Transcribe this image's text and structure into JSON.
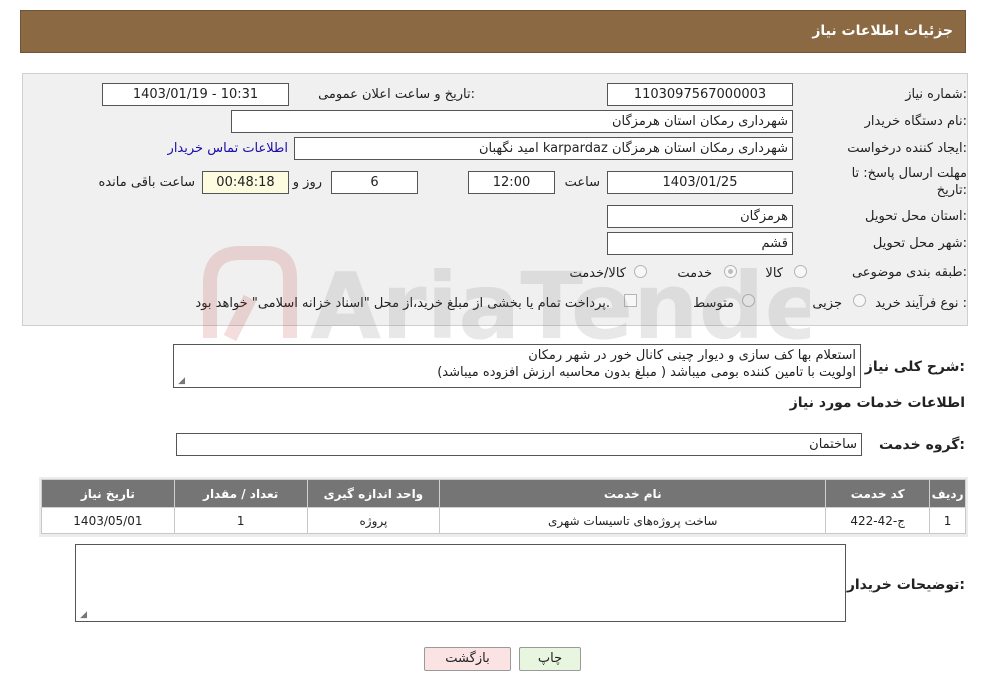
{
  "header": {
    "title": "جزئیات اطلاعات نیاز"
  },
  "form": {
    "need_number_label": "شماره نیاز:",
    "need_number": "1103097567000003",
    "announce_label": "تاریخ و ساعت اعلان عمومی:",
    "announce_value": "1403/01/19 - 10:31",
    "buyer_org_label": "نام دستگاه خریدار:",
    "buyer_org": "شهرداری رمکان استان هرمزگان",
    "creator_label": "ایجاد کننده درخواست:",
    "creator": "امید نگهبان karpardaz شهرداری رمکان استان هرمزگان",
    "contact_link": "اطلاعات تماس خریدار",
    "deadline_label_1": "مهلت ارسال پاسخ: تا",
    "deadline_label_2": "تاریخ:",
    "deadline_date": "1403/01/25",
    "time_label": "ساعت",
    "deadline_time": "12:00",
    "days_value": "6",
    "days_label": "روز و",
    "remaining_value": "00:48:18",
    "remaining_label": "ساعت باقی مانده",
    "province_label": "استان محل تحویل:",
    "province": "هرمزگان",
    "city_label": "شهر محل تحویل:",
    "city": "قشم",
    "category_label": "طبقه بندی موضوعی:",
    "category_options": [
      "کالا",
      "خدمت",
      "کالا/خدمت"
    ],
    "category_selected": "خدمت",
    "purchase_label": "نوع فرآیند خرید :",
    "purchase_options": [
      "جزیی",
      "متوسط"
    ],
    "purchase_note": "پرداخت تمام یا بخشی از مبلغ خرید،از محل \"اسناد خزانه اسلامی\" خواهد بود."
  },
  "description": {
    "label": "شرح کلی نیاز:",
    "line1": "استعلام بها کف سازی و دیوار چینی کانال خور در شهر رمکان",
    "line2": "اولویت با تامین کننده بومی میباشد ( مبلغ بدون محاسبه ارزش افزوده میباشد)"
  },
  "services": {
    "section_title": "اطلاعات خدمات مورد نیاز",
    "group_label": "گروه خدمت:",
    "group_value": "ساختمان",
    "columns": [
      "ردیف",
      "کد خدمت",
      "نام خدمت",
      "واحد اندازه گیری",
      "تعداد / مقدار",
      "تاریخ نیاز"
    ],
    "rows": [
      [
        "1",
        "ج-42-422",
        "ساخت پروژه‌های تاسیسات شهری",
        "پروژه",
        "1",
        "1403/05/01"
      ]
    ]
  },
  "buyer_notes": {
    "label": "توضیحات خریدار:",
    "value": ""
  },
  "buttons": {
    "print": "چاپ",
    "back": "بازگشت"
  },
  "watermark": {
    "text": "AriaTender.neT"
  },
  "colors": {
    "header_bg": "#8b6a43",
    "table_header_bg": "#757575",
    "back_button_bg": "#fbe3e3",
    "print_button_bg": "#e8f6e0"
  }
}
